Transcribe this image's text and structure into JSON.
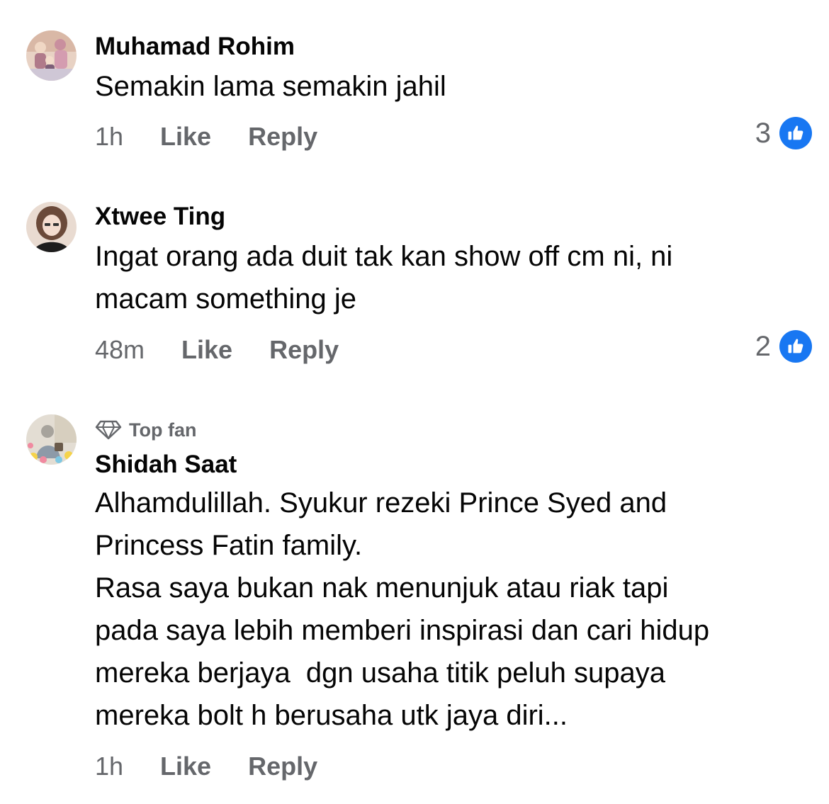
{
  "comments": [
    {
      "author": "Muhamad Rohim",
      "text": "Semakin lama semakin jahil",
      "time": "1h",
      "like_label": "Like",
      "reply_label": "Reply",
      "reaction_count": "3",
      "reaction_icon": "thumbs-up-icon",
      "avatar_icon": "family-photo-avatar"
    },
    {
      "author": "Xtwee Ting",
      "text": "Ingat orang ada duit tak kan show off cm ni, ni\nmacam something je",
      "time": "48m",
      "like_label": "Like",
      "reply_label": "Reply",
      "reaction_count": "2",
      "reaction_icon": "thumbs-up-icon",
      "avatar_icon": "woman-photo-avatar"
    },
    {
      "badge": "Top fan",
      "badge_icon": "diamond-icon",
      "author": "Shidah Saat",
      "text": "Alhamdulillah. Syukur rezeki Prince Syed and\nPrincess Fatin family.\nRasa saya bukan nak menunjuk atau riak tapi\npada saya lebih memberi inspirasi dan cari hidup\nmereka berjaya  dgn usaha titik peluh supaya\nmereka bolt h berusaha utk jaya diri...",
      "time": "1h",
      "like_label": "Like",
      "reply_label": "Reply",
      "avatar_icon": "woman-floral-avatar"
    }
  ],
  "colors": {
    "text_primary": "#050505",
    "text_secondary": "#65676b",
    "like_blue": "#1877f2"
  }
}
